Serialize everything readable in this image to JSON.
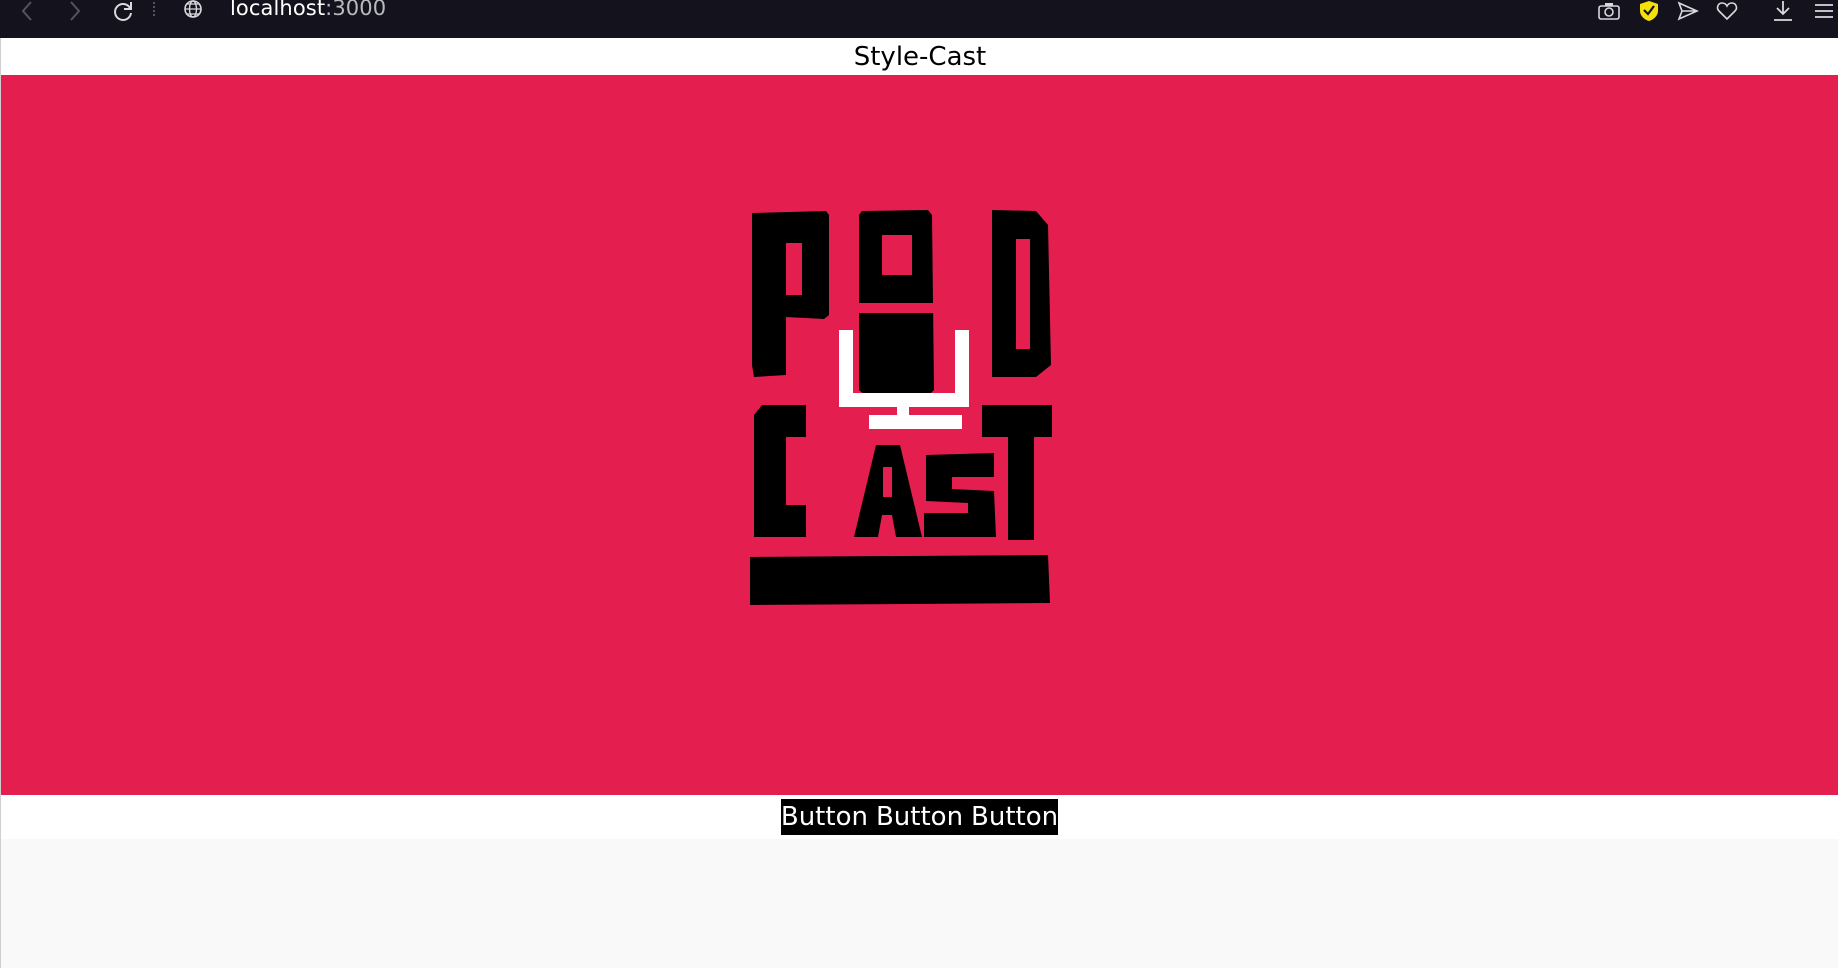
{
  "browser": {
    "url_host": "localhost",
    "url_port": ":3000",
    "icons": [
      "back-icon",
      "forward-icon",
      "reload-icon",
      "globe-icon",
      "camera-icon",
      "shield-icon",
      "send-icon",
      "heart-icon",
      "download-icon",
      "menu-icon"
    ]
  },
  "header": {
    "title": "Style-Cast"
  },
  "hero": {
    "background": "#e41f4f",
    "logo_text_top": "POD",
    "logo_text_bottom": "CAST"
  },
  "buttons": [
    "Button",
    "Button",
    "Button"
  ],
  "colors": {
    "accent": "#e41f4f",
    "chrome": "#14131d"
  }
}
